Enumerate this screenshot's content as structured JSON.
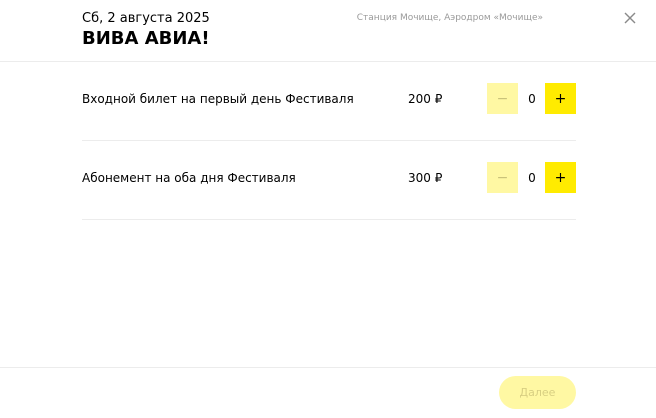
{
  "header": {
    "date": "Сб, 2 августа 2025",
    "title": "ВИВА АВИА!",
    "venue": "Станция Мочище, Аэродром «Мочище»"
  },
  "tickets": [
    {
      "name": "Входной билет на первый день Фестиваля",
      "price": "200 ₽",
      "quantity": "0",
      "minus": "−",
      "plus": "+"
    },
    {
      "name": "Абонемент на оба дня Фестиваля",
      "price": "300 ₽",
      "quantity": "0",
      "minus": "−",
      "plus": "+"
    }
  ],
  "footer": {
    "next_label": "Далее"
  },
  "colors": {
    "accent": "#ffeb00",
    "accent_disabled": "#fff8a3"
  }
}
